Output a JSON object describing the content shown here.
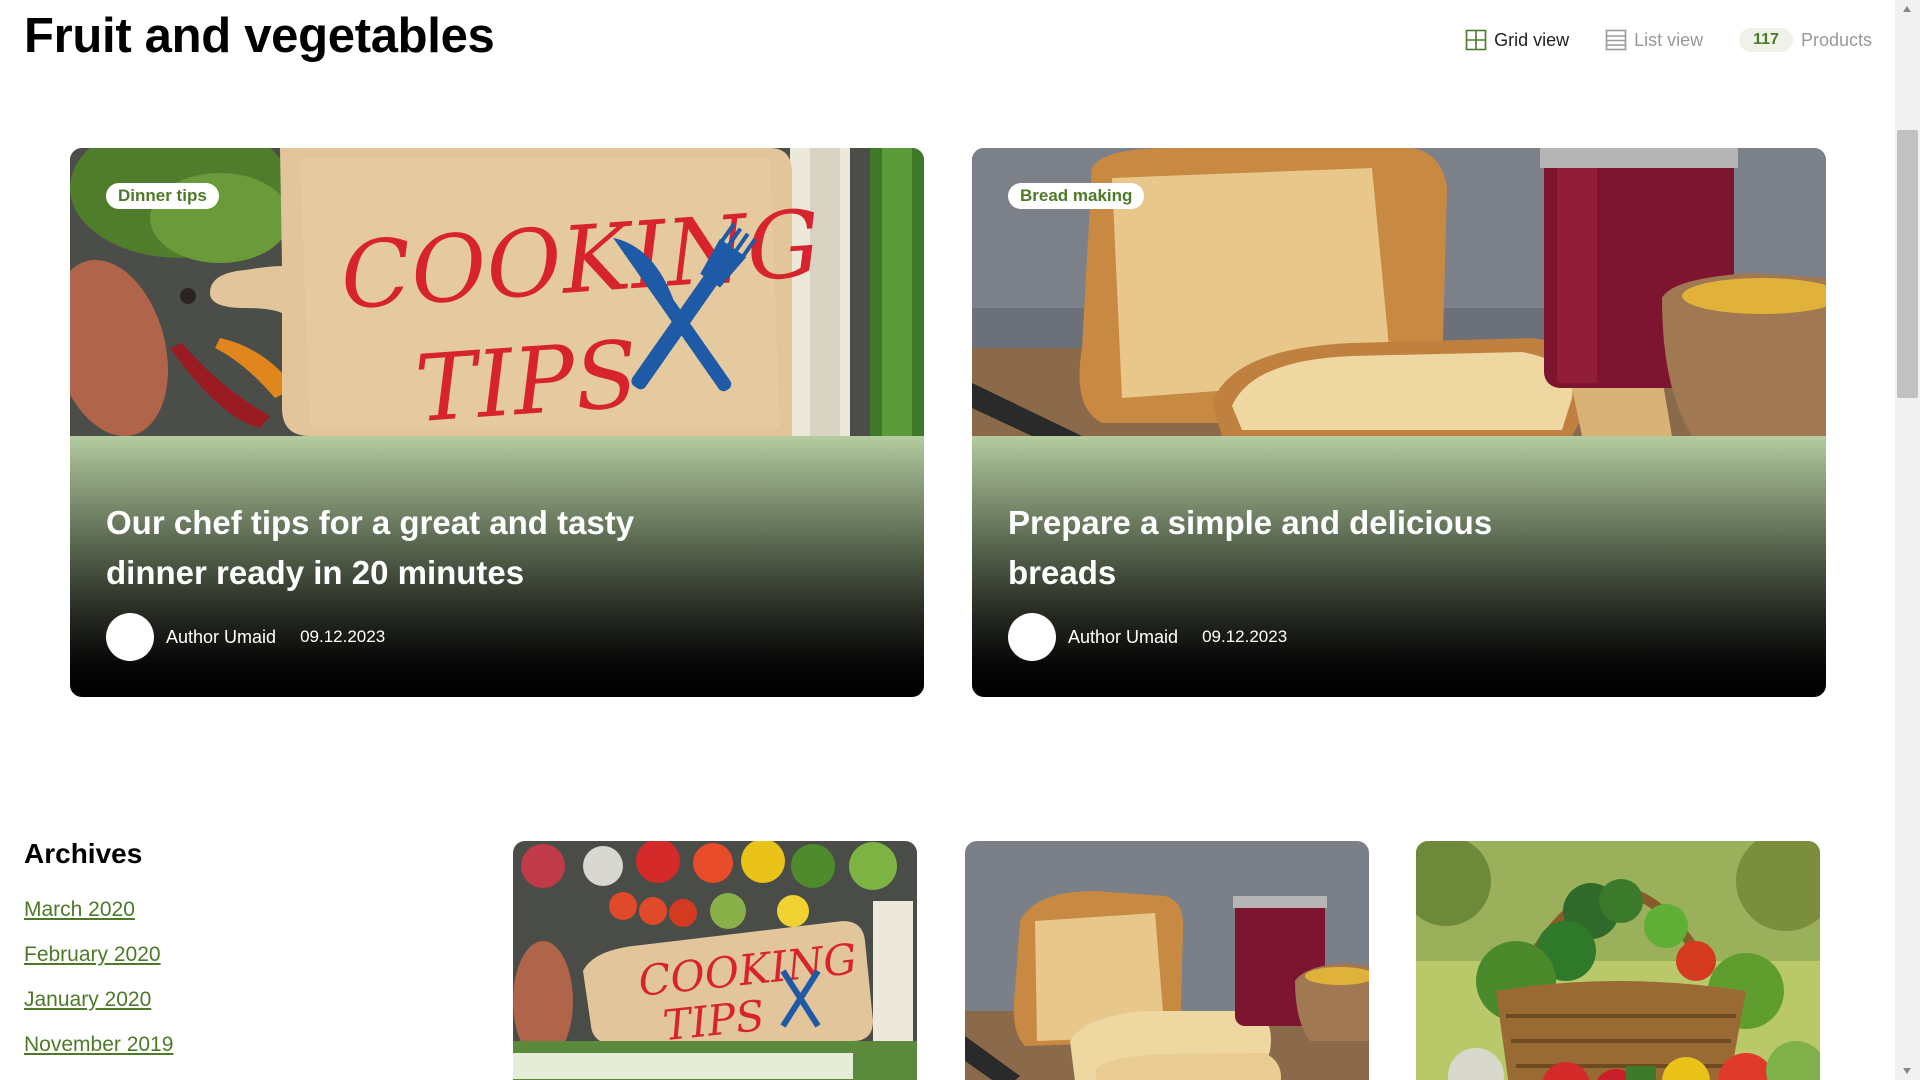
{
  "header": {
    "title": "Fruit and vegetables",
    "grid_view_label": "Grid view",
    "list_view_label": "List view",
    "products_count": "117",
    "products_label": "Products"
  },
  "featured": [
    {
      "tag": "Dinner tips",
      "title": "Our chef tips for a great and tasty dinner ready in 20 minutes",
      "author": "Author Umaid",
      "date": "09.12.2023",
      "image": "cooking-tips-cutting-board-photo",
      "image_text": [
        "COOKING",
        "TIPS"
      ]
    },
    {
      "tag": "Bread making",
      "title": "Prepare a simple and delicious breads",
      "author": "Author Umaid",
      "date": "09.12.2023",
      "image": "bread-and-jam-photo"
    }
  ],
  "archives": {
    "heading": "Archives",
    "links": [
      "March 2020",
      "February 2020",
      "January 2020",
      "November 2019"
    ]
  },
  "thumbnails": [
    {
      "image": "cooking-tips-vegetables-photo",
      "image_text": [
        "COOKING",
        "TIPS"
      ]
    },
    {
      "image": "bread-and-jam-photo"
    },
    {
      "image": "vegetable-basket-photo"
    }
  ],
  "colors": {
    "accent": "#4d7a28",
    "badge_bg": "#eef2e8",
    "card_fade_top": "#b5cca0",
    "card_fade_bottom": "#000000",
    "title_red": "#d7232e",
    "fork_blue": "#1f5aa6"
  }
}
